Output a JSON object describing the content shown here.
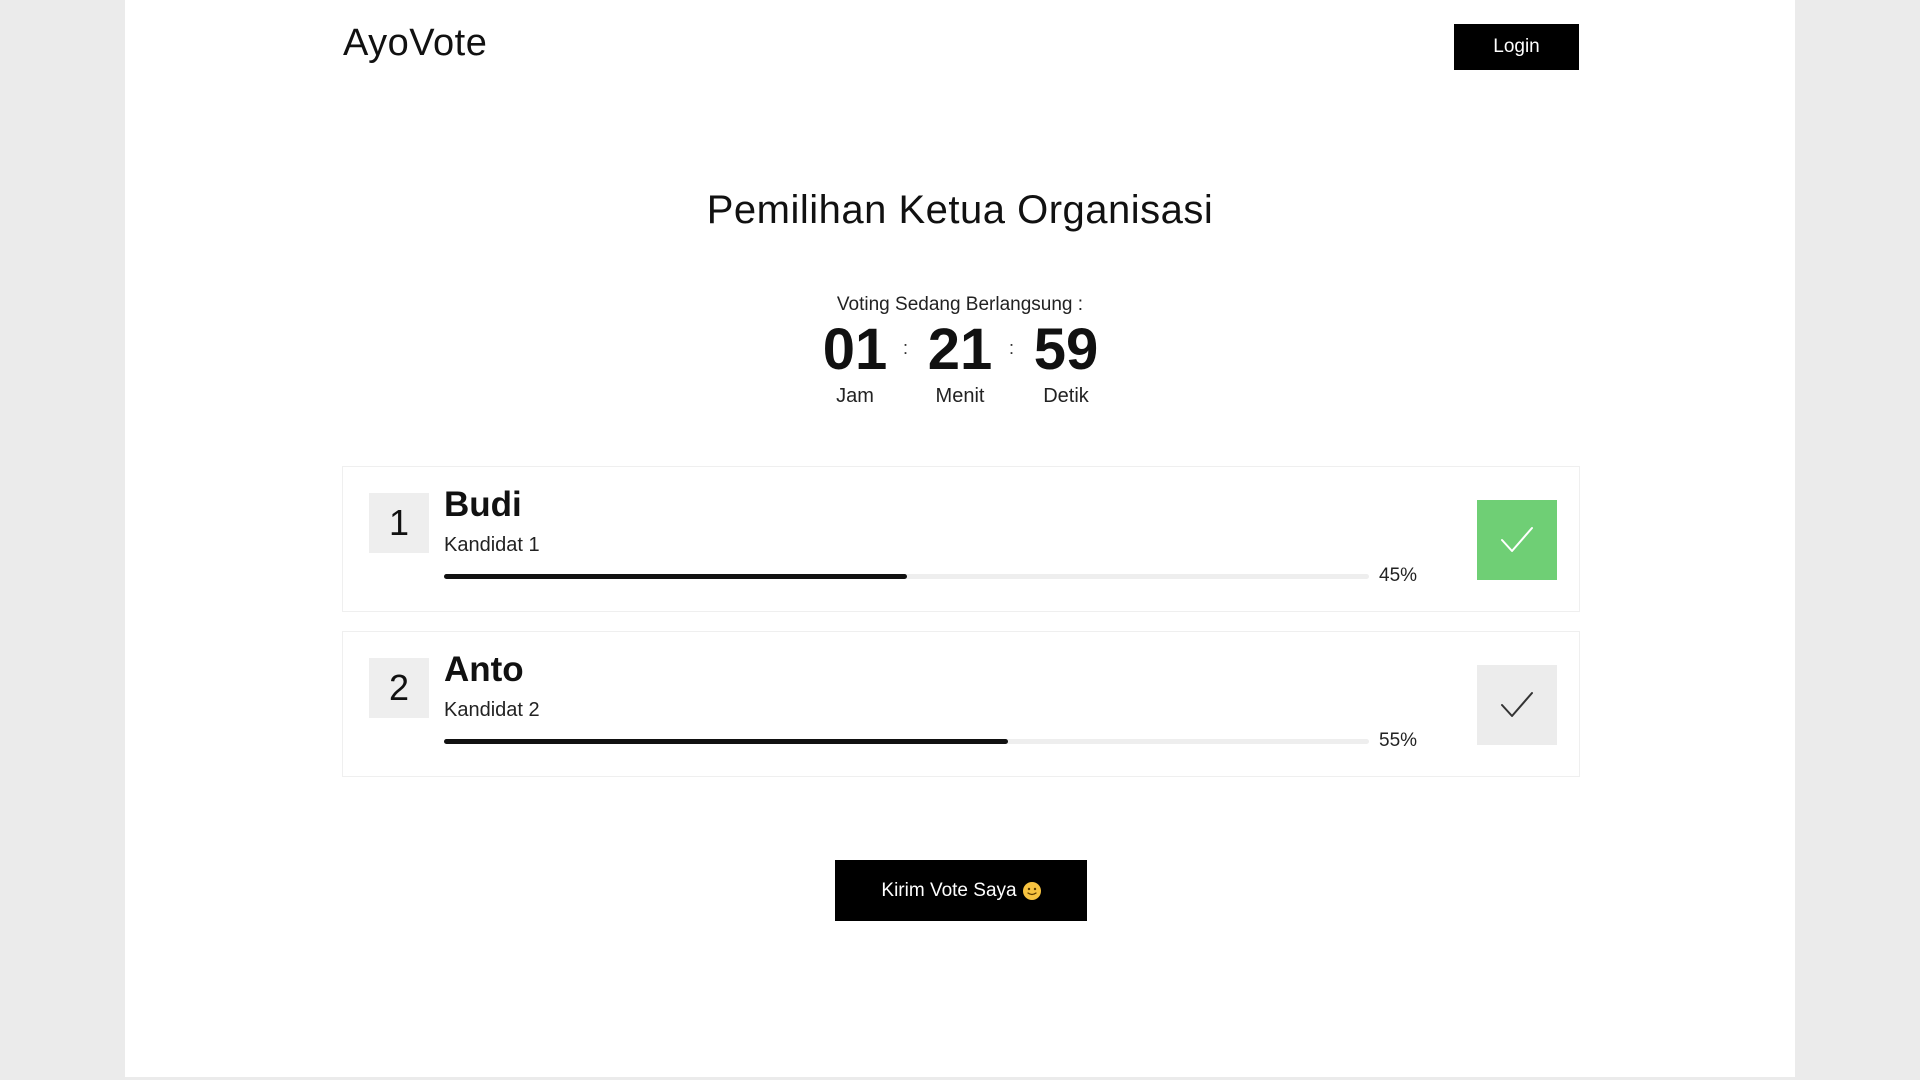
{
  "header": {
    "brand": "AyoVote",
    "login_label": "Login"
  },
  "main": {
    "title": "Pemilihan Ketua Organisasi",
    "status_label": "Voting Sedang Berlangsung :",
    "countdown": {
      "hours": "01",
      "hours_label": "Jam",
      "minutes": "21",
      "minutes_label": "Menit",
      "seconds": "59",
      "seconds_label": "Detik",
      "separator": ":"
    },
    "candidates": [
      {
        "number": "1",
        "name": "Budi",
        "subtitle": "Kandidat 1",
        "percent_label": "45%",
        "progress_percent": 50,
        "selected": true
      },
      {
        "number": "2",
        "name": "Anto",
        "subtitle": "Kandidat 2",
        "percent_label": "55%",
        "progress_percent": 61,
        "selected": false
      }
    ],
    "submit_label": "Kirim Vote Saya"
  },
  "icons": {
    "check": "checkmark-icon",
    "emoji": "smiling-face-emoji-icon"
  },
  "colors": {
    "selected_check_bg": "#6fcf75",
    "unselected_check_bg": "#ececec",
    "primary_button": "#000000",
    "progress_fill": "#111111"
  }
}
